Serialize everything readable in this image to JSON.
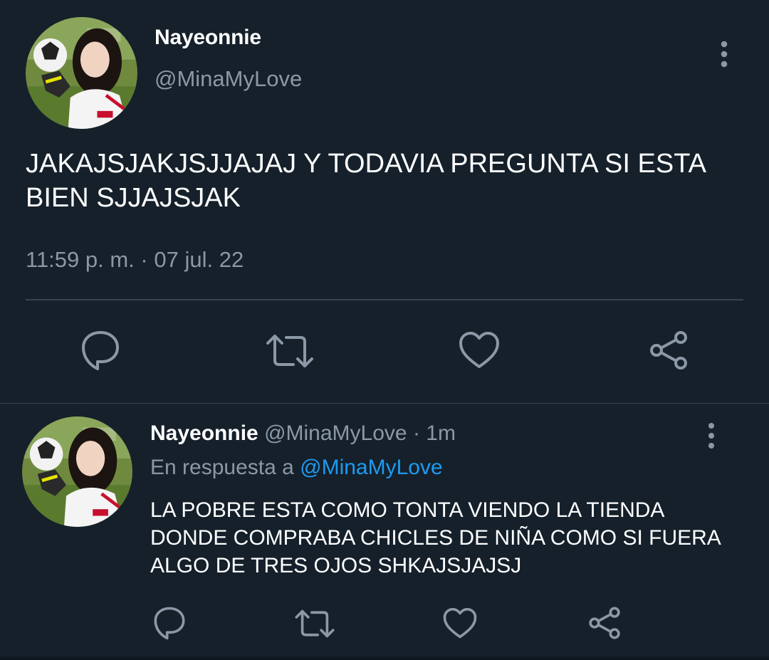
{
  "main_tweet": {
    "author_name": "Nayeonnie",
    "author_handle": "@MinaMyLove",
    "text": "JAKAJSJAKJSJJAJAJ Y TODAVIA PREGUNTA SI ESTA BIEN SJJAJSJAK",
    "time": "11:59 p. m.",
    "separator": "·",
    "date": "07 jul. 22",
    "more_icon": "more-vertical-icon",
    "actions": [
      "reply-icon",
      "retweet-icon",
      "like-icon",
      "share-icon"
    ]
  },
  "reply_tweet": {
    "author_name": "Nayeonnie",
    "author_handle": "@MinaMyLove",
    "separator": "·",
    "time": "1m",
    "reply_context_prefix": "En respuesta a",
    "reply_context_mention": "@MinaMyLove",
    "text": "LA POBRE ESTA COMO TONTA VIENDO LA TIENDA DONDE COMPRABA CHICLES DE NIÑA COMO SI FUERA ALGO DE TRES OJOS SHKAJSJAJSJ",
    "more_icon": "more-vertical-icon",
    "actions": [
      "reply-icon",
      "retweet-icon",
      "like-icon",
      "share-icon"
    ]
  },
  "colors": {
    "background": "#15202b",
    "text_primary": "#ffffff",
    "text_secondary": "#8b98a5",
    "link": "#1d9bf0",
    "divider": "#38444d"
  }
}
